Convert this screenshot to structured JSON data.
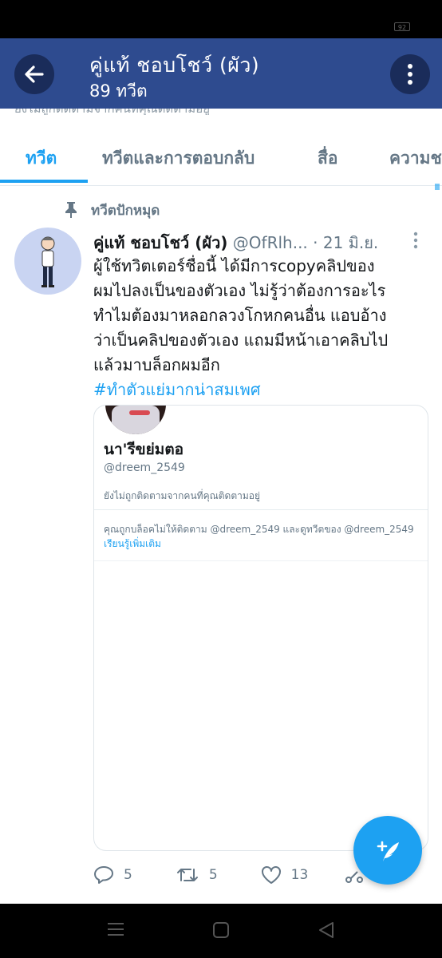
{
  "status_bar": {
    "battery": "92"
  },
  "header": {
    "title": "คู่แท้ ชอบโชว์ (ผัว)",
    "subtitle": "89 ทวีต",
    "icons": {
      "back": "arrow-left-icon",
      "more": "more-vertical-icon"
    }
  },
  "tabs": [
    {
      "label": "ทวีต",
      "active": true
    },
    {
      "label": "ทวีตและการตอบกลับ",
      "active": false
    },
    {
      "label": "สื่อ",
      "active": false
    },
    {
      "label": "ความชอบ",
      "active": false
    }
  ],
  "pinned": {
    "label": "ทวีตปักหมุด",
    "icon": "pin-icon"
  },
  "tweet": {
    "name": "คู่แท้ ชอบโชว์ (ผัว)",
    "handle": "@OfRlh...",
    "date": "· 21 มิ.ย.",
    "lines": [
      "ผู้ใช้ทวิตเตอร์ชื่อนี้  ได้มีการcopyคลิปของ",
      "ผมไปลงเป็นของตัวเอง  ไม่รู้ว่าต้องการอะไร",
      "ทำไมต้องมาหลอกลวงโกหกคนอื่น  แอบอ้าง",
      "ว่าเป็นคลิปของตัวเอง  แถมมีหน้าเอาคลิบไป",
      "แล้วมาบล็อกผมอีก"
    ],
    "hashtag": "#ทำตัวแย่มากน่าสมเพศ",
    "card": {
      "name": "นา'รีขย่มตอ",
      "handle": "@dreem_2549",
      "status": "ยังไม่ถูกติดตามจากคนที่คุณติดตามอยู่",
      "notice": "คุณถูกบล็อคไม่ให้ติดตาม @dreem_2549 และดูทวีตของ @dreem_2549",
      "link": "เรียนรู้เพิ่มเติม"
    },
    "actions": {
      "replies": "5",
      "retweets": "5",
      "likes": "13"
    }
  },
  "fab": {
    "icon": "compose-tweet-icon"
  },
  "colors": {
    "header": "#2e4b8f",
    "accent": "#1da1f2",
    "muted": "#657786"
  }
}
